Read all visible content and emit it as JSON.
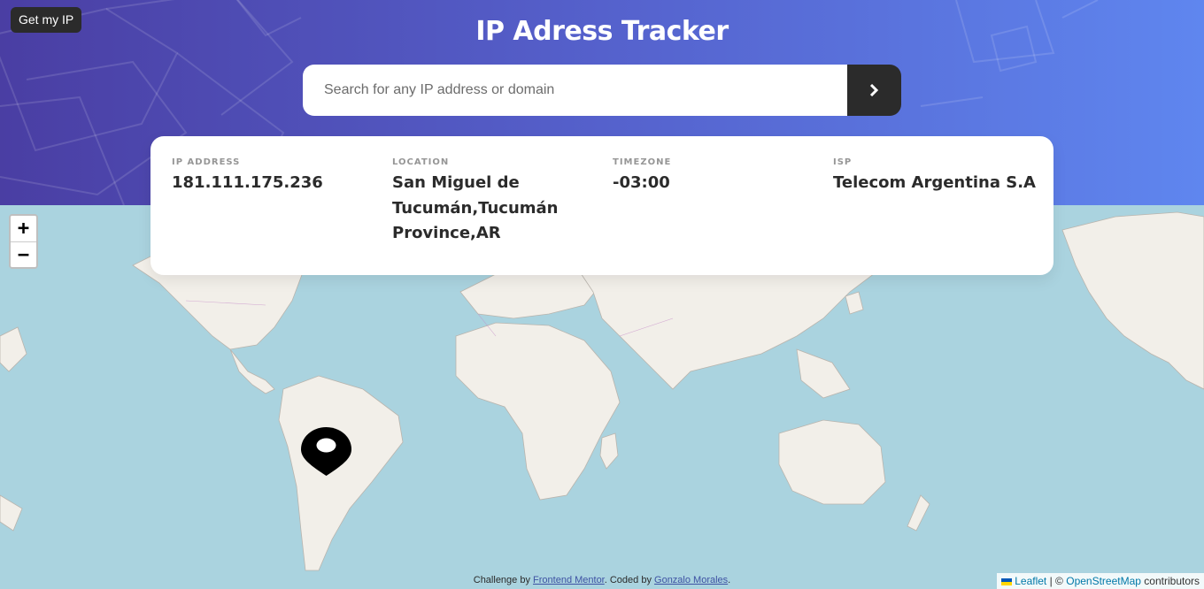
{
  "header": {
    "get_ip_label": "Get my IP",
    "title": "IP Adress Tracker",
    "search_placeholder": "Search for any IP address or domain",
    "search_value": ""
  },
  "info": {
    "ip_label": "IP ADDRESS",
    "ip_value": "181.111.175.236",
    "location_label": "LOCATION",
    "location_value": "San Miguel de Tucumán,Tucumán Province,AR",
    "timezone_label": "TIMEZONE",
    "timezone_value": "-03:00",
    "isp_label": "ISP",
    "isp_value": "Telecom Argentina S.A"
  },
  "map": {
    "zoom_in": "+",
    "zoom_out": "−",
    "attribution_leaflet": "Leaflet",
    "attribution_sep": "| ©",
    "attribution_osm": "OpenStreetMap",
    "attribution_tail": "contributors"
  },
  "footer": {
    "challenge_by": "Challenge by",
    "frontend_mentor": "Frontend Mentor",
    "coded_by": ". Coded by",
    "author": "Gonzalo Morales",
    "end": "."
  },
  "colors": {
    "ocean": "#aad3df",
    "land": "#f2efe9",
    "button_dark": "#2b2b2b",
    "gradient_start": "#4a3ea3",
    "gradient_end": "#5f86ef"
  }
}
